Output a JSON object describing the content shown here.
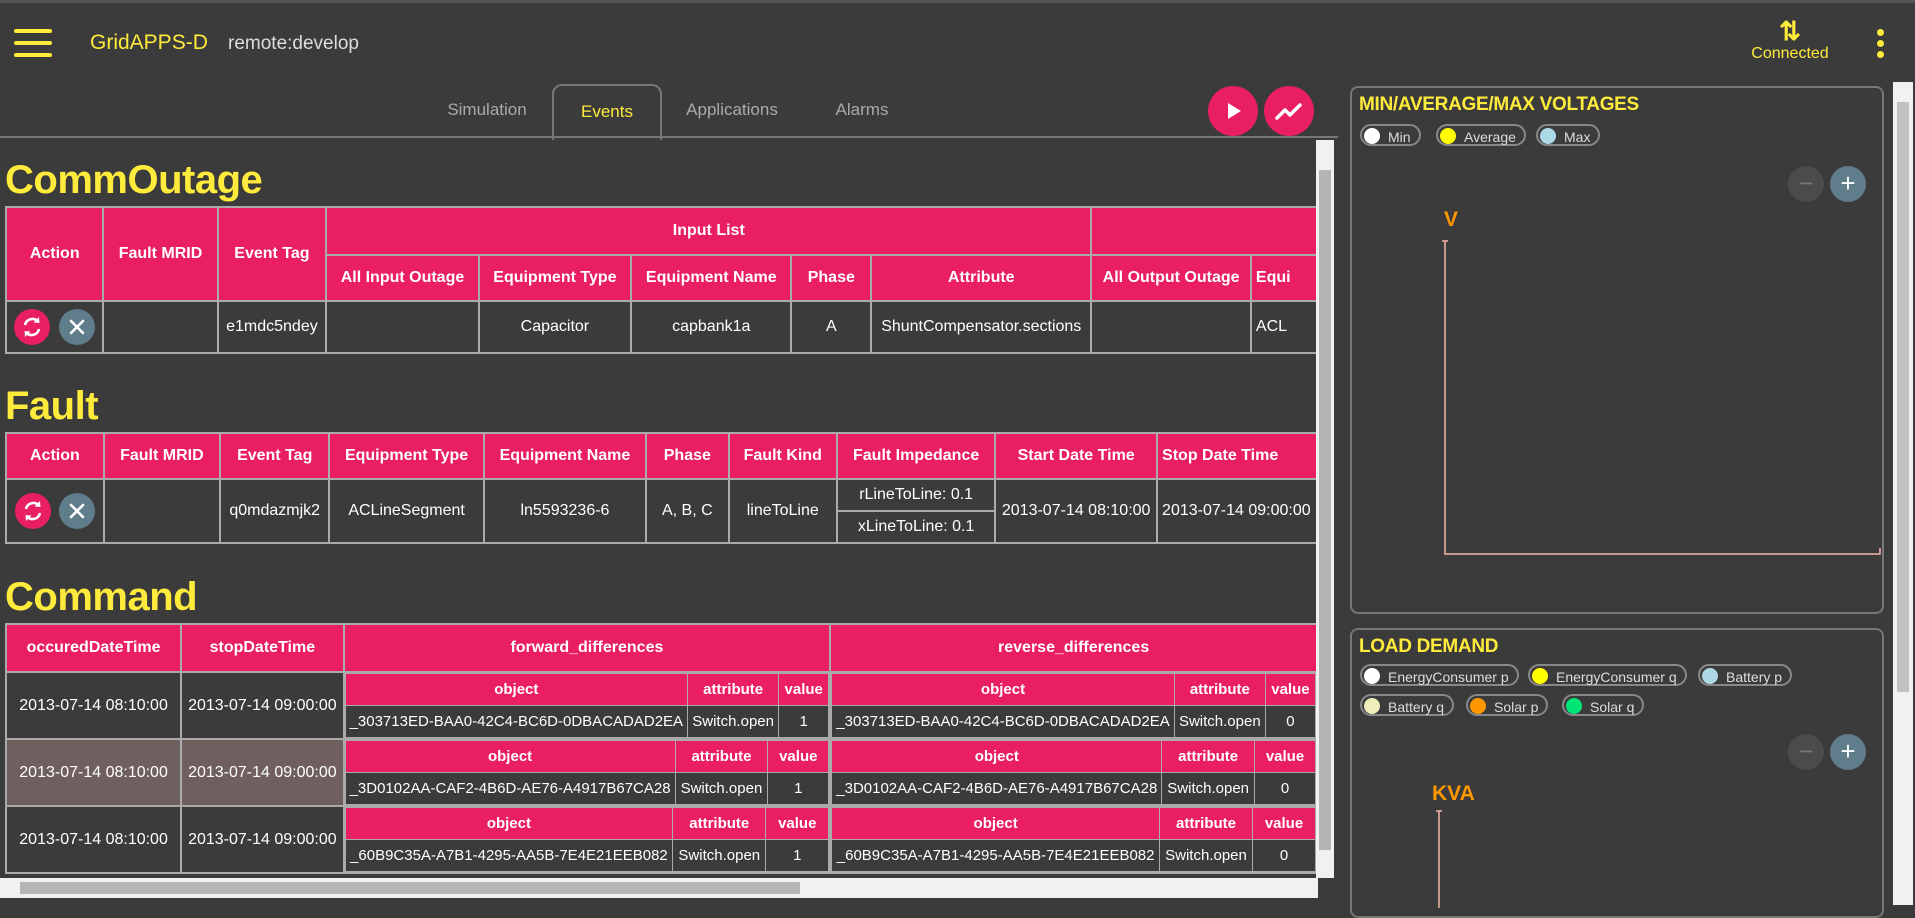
{
  "header": {
    "app_title": "GridAPPS-D",
    "environment": "remote:develop",
    "connection_status": "Connected"
  },
  "tabs": [
    {
      "label": "Simulation"
    },
    {
      "label": "Events"
    },
    {
      "label": "Applications"
    },
    {
      "label": "Alarms"
    }
  ],
  "comm_outage": {
    "title": "CommOutage",
    "headers": {
      "action": "Action",
      "fault_mrid": "Fault MRID",
      "event_tag": "Event Tag",
      "input_list": "Input List",
      "all_input_outage": "All Input Outage",
      "equipment_type": "Equipment Type",
      "equipment_name": "Equipment Name",
      "phase": "Phase",
      "attribute": "Attribute",
      "all_output_outage": "All Output Outage",
      "equipment_trunc": "Equi"
    },
    "row": {
      "fault_mrid": "",
      "event_tag": "e1mdc5ndey",
      "all_input_outage": "",
      "equipment_type": "Capacitor",
      "equipment_name": "capbank1a",
      "phase": "A",
      "attribute": "ShuntCompensator.sections",
      "all_output_outage": "",
      "equipment_trunc": "ACL"
    }
  },
  "fault": {
    "title": "Fault",
    "headers": {
      "action": "Action",
      "fault_mrid": "Fault MRID",
      "event_tag": "Event Tag",
      "equipment_type": "Equipment Type",
      "equipment_name": "Equipment Name",
      "phase": "Phase",
      "fault_kind": "Fault Kind",
      "fault_impedance": "Fault Impedance",
      "start": "Start Date Time",
      "stop": "Stop Date Time"
    },
    "row": {
      "fault_mrid": "",
      "event_tag": "q0mdazmjk2",
      "equipment_type": "ACLineSegment",
      "equipment_name": "ln5593236-6",
      "phase": "A, B, C",
      "fault_kind": "lineToLine",
      "impedance_r": "rLineToLine: 0.1",
      "impedance_x": "xLineToLine: 0.1",
      "start": "2013-07-14 08:10:00",
      "stop": "2013-07-14 09:00:00"
    }
  },
  "command": {
    "title": "Command",
    "headers": {
      "occured": "occuredDateTime",
      "stop": "stopDateTime",
      "forward": "forward_differences",
      "reverse": "reverse_differences",
      "object": "object",
      "attribute": "attribute",
      "value": "value"
    },
    "rows": [
      {
        "occured": "2013-07-14 08:10:00",
        "stop": "2013-07-14 09:00:00",
        "f_object": "_303713ED-BAA0-42C4-BC6D-0DBACADAD2EA",
        "f_attribute": "Switch.open",
        "f_value": "1",
        "r_object": "_303713ED-BAA0-42C4-BC6D-0DBACADAD2EA",
        "r_attribute": "Switch.open",
        "r_value": "0"
      },
      {
        "occured": "2013-07-14 08:10:00",
        "stop": "2013-07-14 09:00:00",
        "f_object": "_3D0102AA-CAF2-4B6D-AE76-A4917B67CA28",
        "f_attribute": "Switch.open",
        "f_value": "1",
        "r_object": "_3D0102AA-CAF2-4B6D-AE76-A4917B67CA28",
        "r_attribute": "Switch.open",
        "r_value": "0"
      },
      {
        "occured": "2013-07-14 08:10:00",
        "stop": "2013-07-14 09:00:00",
        "f_object": "_60B9C35A-A7B1-4295-AA5B-7E4E21EEB082",
        "f_attribute": "Switch.open",
        "f_value": "1",
        "r_object": "_60B9C35A-A7B1-4295-AA5B-7E4E21EEB082",
        "r_attribute": "Switch.open",
        "r_value": "0"
      }
    ]
  },
  "voltage_panel": {
    "title": "MIN/AVERAGE/MAX VOLTAGES",
    "legend": [
      {
        "name": "Min",
        "color": "#ffffff"
      },
      {
        "name": "Average",
        "color": "#ffff00"
      },
      {
        "name": "Max",
        "color": "#add8e6"
      }
    ],
    "y_label": "V"
  },
  "load_panel": {
    "title": "LOAD DEMAND",
    "legend": [
      {
        "name": "EnergyConsumer p",
        "color": "#ffffff"
      },
      {
        "name": "EnergyConsumer q",
        "color": "#ffff00"
      },
      {
        "name": "Battery p",
        "color": "#add8e6"
      },
      {
        "name": "Battery q",
        "color": "#eeeebb"
      },
      {
        "name": "Solar p",
        "color": "#ff9800"
      },
      {
        "name": "Solar q",
        "color": "#00e676"
      }
    ],
    "y_label": "KVA"
  },
  "colors": {
    "accent": "#ffeb3b",
    "primary": "#e91e63",
    "secondary": "#607d8b",
    "background": "#3b3b3b",
    "axis": "#ff9800"
  }
}
